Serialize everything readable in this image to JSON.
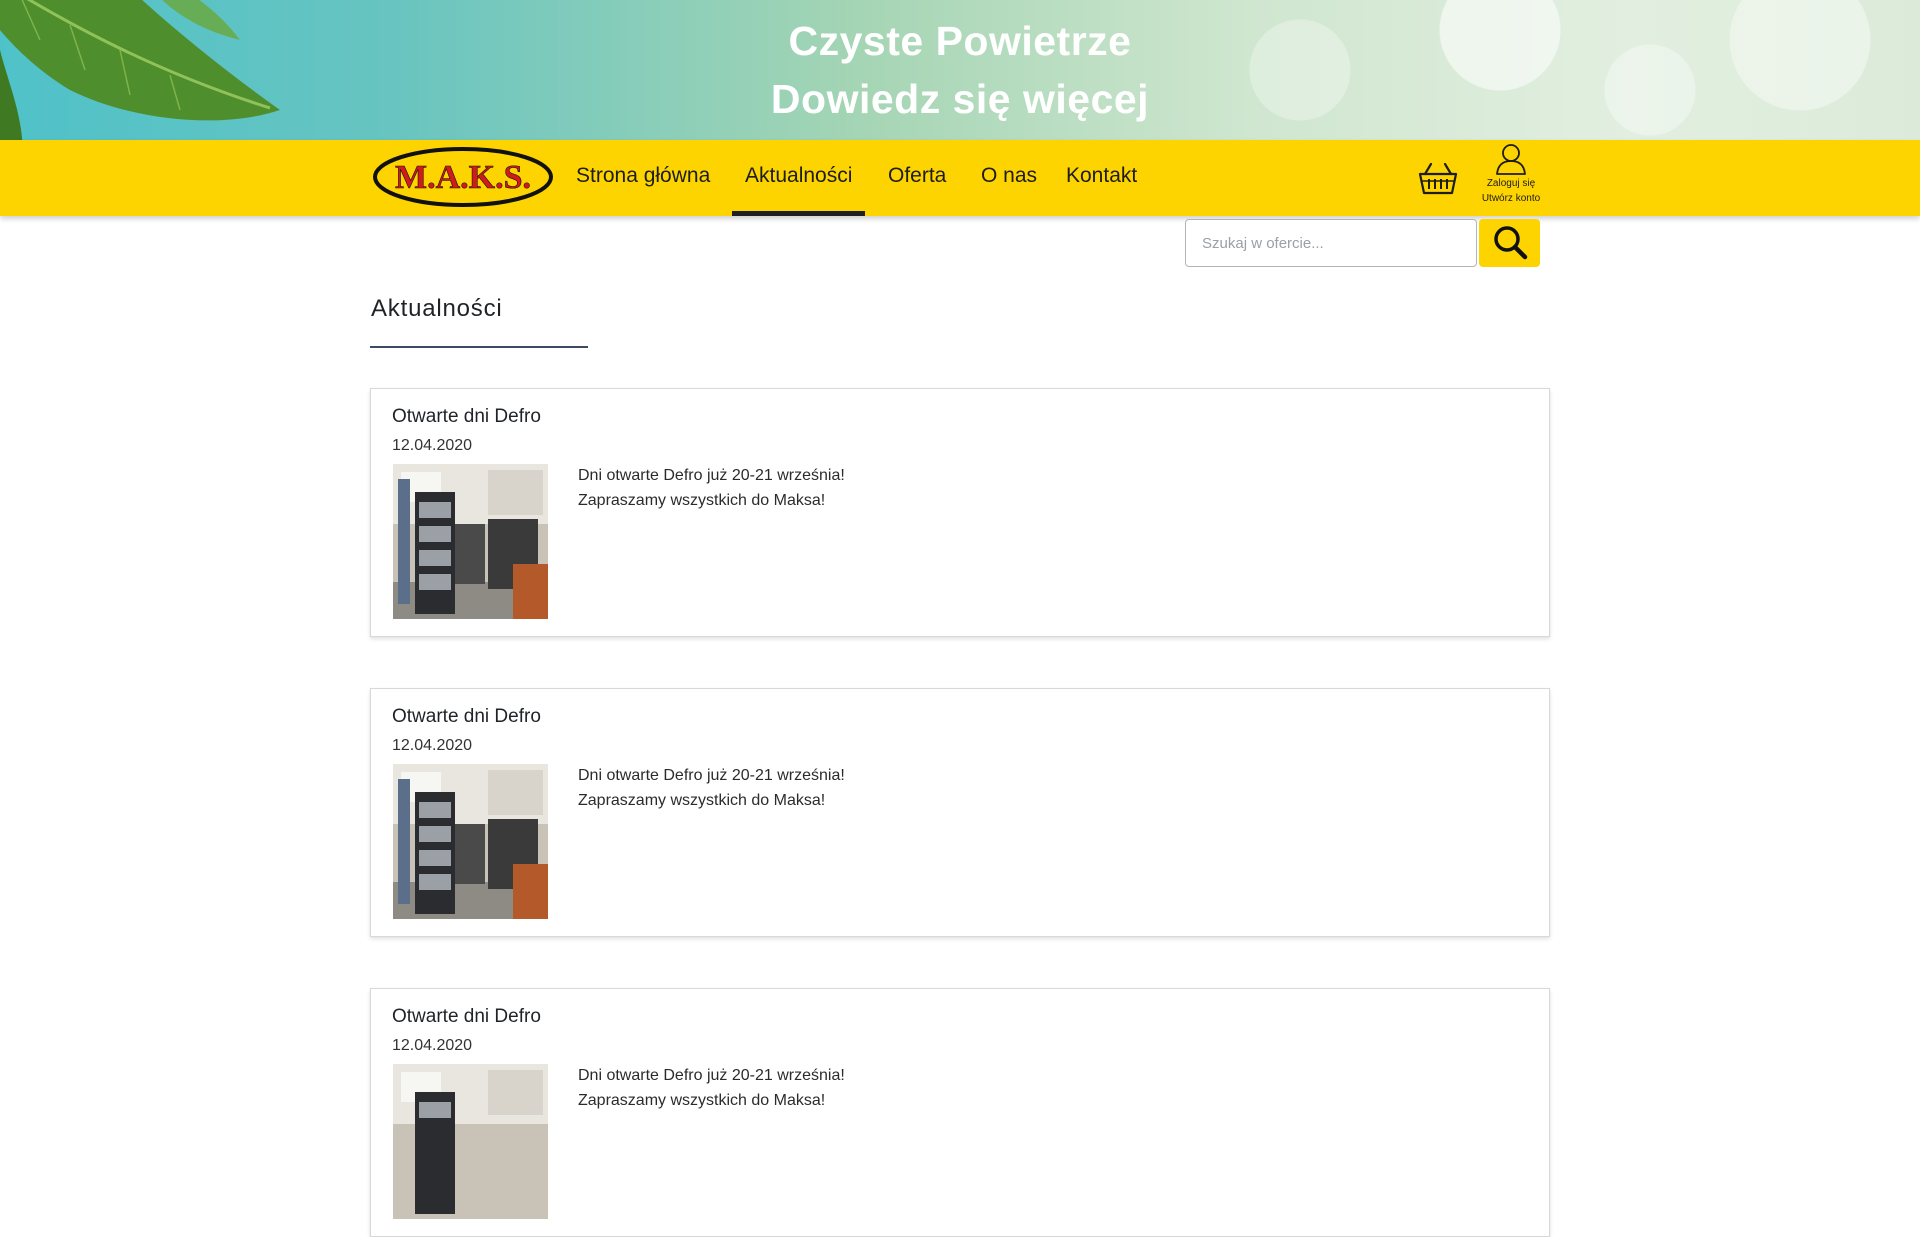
{
  "banner": {
    "line1": "Czyste Powietrze",
    "line2": "Dowiedz się więcej"
  },
  "brand": {
    "logo_text": "M.A.K.S."
  },
  "nav": {
    "items": [
      {
        "label": "Strona główna",
        "active": false
      },
      {
        "label": "Aktualności",
        "active": true
      },
      {
        "label": "Oferta",
        "active": false
      },
      {
        "label": "O nas",
        "active": false
      },
      {
        "label": "Kontakt",
        "active": false
      }
    ]
  },
  "account": {
    "login_label": "Zaloguj się",
    "register_label": "Utwórz konto"
  },
  "search": {
    "placeholder": "Szukaj w ofercie...",
    "value": ""
  },
  "page": {
    "heading": "Aktualności"
  },
  "news": [
    {
      "title": "Otwarte dni Defro",
      "date": "12.04.2020",
      "text_line1": "Dni otwarte Defro już 20-21 września!",
      "text_line2": "Zapraszamy wszystkich do Maksa!"
    },
    {
      "title": "Otwarte dni Defro",
      "date": "12.04.2020",
      "text_line1": "Dni otwarte Defro już 20-21 września!",
      "text_line2": "Zapraszamy wszystkich do Maksa!"
    },
    {
      "title": "Otwarte dni Defro",
      "date": "12.04.2020",
      "text_line1": "Dni otwarte Defro już 20-21 września!",
      "text_line2": "Zapraszamy wszystkich do Maksa!"
    }
  ],
  "colors": {
    "accent_yellow": "#fdd300",
    "logo_red": "#d11a1a",
    "heading_rule": "#3d4a66"
  }
}
